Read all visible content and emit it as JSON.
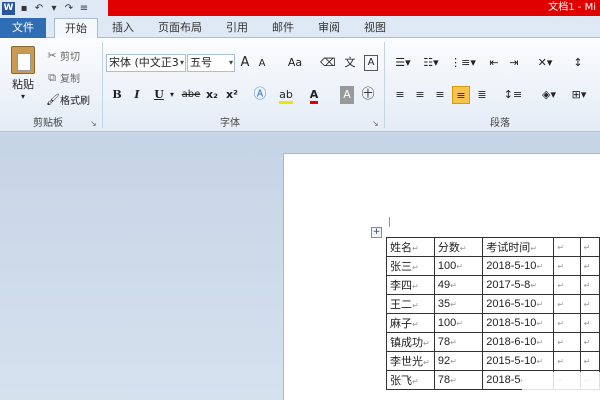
{
  "titlebar": {
    "app_icon_letter": "W",
    "doc_title": "文档1 - Mi"
  },
  "tabs": {
    "file": "文件",
    "items": [
      "开始",
      "插入",
      "页面布局",
      "引用",
      "邮件",
      "审阅",
      "视图"
    ],
    "active": "开始"
  },
  "clipboard": {
    "paste": "粘贴",
    "cut": "剪切",
    "copy": "复制",
    "format_painter": "格式刷",
    "group_label": "剪贴板"
  },
  "font": {
    "font_name": "宋体 (中文正3",
    "font_size": "五号",
    "grow": "A",
    "shrink": "A",
    "change_case": "Aa",
    "phonetic": "文",
    "char_border": "A",
    "bold": "B",
    "italic": "I",
    "underline": "U",
    "strikethrough": "abe",
    "subscript": "x₂",
    "superscript": "x²",
    "group_label": "字体"
  },
  "paragraph": {
    "group_label": "段落"
  },
  "table": {
    "rows": [
      [
        "姓名",
        "分数",
        "考试时间",
        "",
        ""
      ],
      [
        "张三",
        "100",
        "2018-5-10",
        "",
        ""
      ],
      [
        "李四",
        "49",
        "2017-5-8",
        "",
        ""
      ],
      [
        "王二",
        "35",
        "2016-5-10",
        "",
        ""
      ],
      [
        "麻子",
        "100",
        "2018-5-10",
        "",
        ""
      ],
      [
        "镇成功",
        "78",
        "2018-6-10",
        "",
        ""
      ],
      [
        "李世光",
        "92",
        "2015-5-10",
        "",
        ""
      ],
      [
        "张飞",
        "78",
        "2018-5",
        "",
        ""
      ]
    ],
    "cell_mark": "↵"
  },
  "colors": {
    "titlebar_red": "#e00000",
    "file_tab_blue": "#2f6eb5",
    "align_highlight": "#f6c44d"
  }
}
